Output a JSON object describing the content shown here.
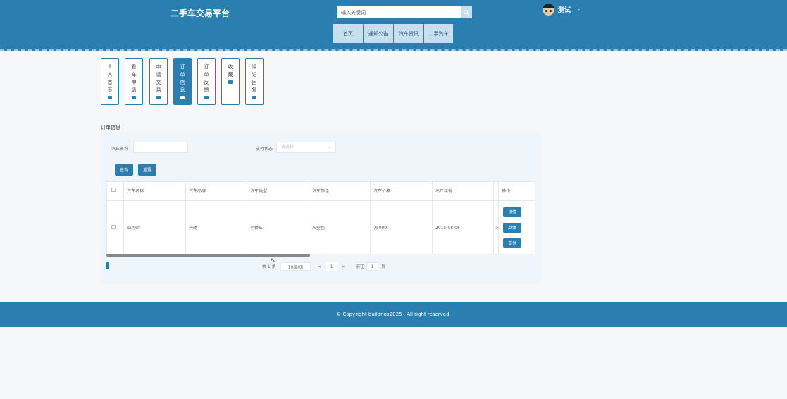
{
  "header": {
    "site_title": "二手车交易平台",
    "search": {
      "placeholder": "输入关键词"
    },
    "user": {
      "name": "测试",
      "caret": "-"
    }
  },
  "nav": {
    "items": [
      {
        "label": "首页"
      },
      {
        "label": "通知公告"
      },
      {
        "label": "汽车资讯"
      },
      {
        "label": "二手汽车"
      }
    ]
  },
  "side_tabs": [
    {
      "label": "个人首页",
      "active": false
    },
    {
      "label": "看车申请",
      "active": false
    },
    {
      "label": "申请交易",
      "active": false
    },
    {
      "label": "订单信息",
      "active": true
    },
    {
      "label": "订单反馈",
      "active": false
    },
    {
      "label": "收藏",
      "active": false
    },
    {
      "label": "评论回复",
      "active": false
    }
  ],
  "section_title": "订单信息",
  "filters": {
    "car_name_label": "汽车名称",
    "pay_status_label": "支付状态",
    "pay_status_placeholder": "请选择",
    "query_button": "查询",
    "reset_button": "重置"
  },
  "table": {
    "headers": [
      "汽车名称",
      "汽车品牌",
      "汽车类型",
      "汽车颜色",
      "汽车价格",
      "出厂年份",
      "操作"
    ],
    "rows": [
      {
        "car_name": "山河砂",
        "brand": "奔驰",
        "type": "小轿车",
        "color": "灰空色",
        "price": "75000",
        "year": "2015-08-06",
        "overflow_mark": ">"
      }
    ],
    "actions": [
      "详情",
      "反馈",
      "支付"
    ]
  },
  "pagination": {
    "total": "共 1 条",
    "page_size": "10条/页",
    "prev": "<",
    "current_page": "1",
    "next": ">",
    "goto_prefix": "前往",
    "goto_value": "1",
    "goto_suffix": "页"
  },
  "footer": {
    "copyright": "© Copyright buildnox2025 . All right reserved."
  },
  "colors": {
    "primary": "#2b7fb0",
    "nav_item_bg": "#c7e0ef",
    "panel_bg": "#eef5fb",
    "page_bg": "#f5f7f8"
  },
  "icons": [
    "search-icon",
    "avatar",
    "tab-icon",
    "checkbox",
    "select-caret-icon",
    "cursor"
  ]
}
